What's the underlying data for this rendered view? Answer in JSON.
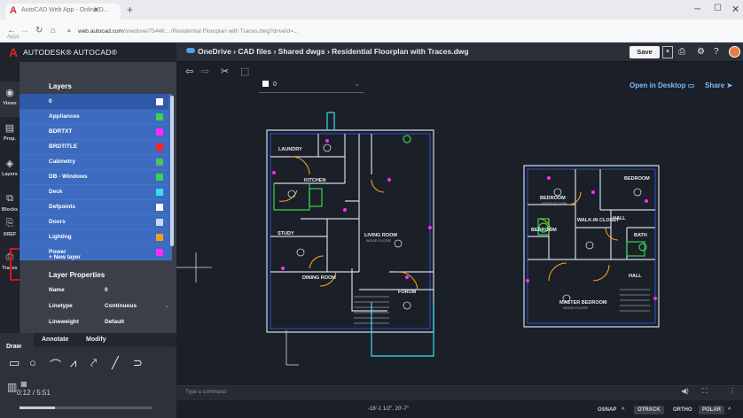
{
  "browser": {
    "tab_title": "AutoCAD Web App - Online D...",
    "url_host": "web.autocad.com",
    "url_rest": "/onedrive/75446... /Residential Floorplan with Traces.dwg?driveId=...",
    "bookmarks_label": "Apps"
  },
  "app": {
    "brand": "AUTODESK® AUTOCAD®",
    "breadcrumb": "OneDrive  ›  CAD files  ›  Shared dwgs  ›  Residential Floorplan with Traces.dwg",
    "save_label": "Save",
    "open_desktop": "Open in Desktop",
    "share_label": "Share"
  },
  "rail": [
    {
      "icon": "views-icon",
      "label": "Views"
    },
    {
      "icon": "properties-icon",
      "label": "Prop."
    },
    {
      "icon": "layers-icon",
      "label": "Layers"
    },
    {
      "icon": "blocks-icon",
      "label": "Blocks"
    },
    {
      "icon": "xref-icon",
      "label": "XREF"
    },
    {
      "icon": "traces-icon",
      "label": "Traces"
    }
  ],
  "layers": {
    "title": "Layers",
    "current": "0",
    "items": [
      {
        "name": "0",
        "color": "#ffffff"
      },
      {
        "name": "Appliances",
        "color": "#39d353"
      },
      {
        "name": "BDRTXT",
        "color": "#ff2bff"
      },
      {
        "name": "BRDTITLE",
        "color": "#ff2020"
      },
      {
        "name": "Cabinetry",
        "color": "#50c060"
      },
      {
        "name": "DB - Windows",
        "color": "#39d353"
      },
      {
        "name": "Deck",
        "color": "#33e0f0"
      },
      {
        "name": "Defpoints",
        "color": "#ffffff"
      },
      {
        "name": "Doors",
        "color": "#cfd8ea"
      },
      {
        "name": "Lighting",
        "color": "#f0a020"
      },
      {
        "name": "Power",
        "color": "#ff2bff"
      }
    ],
    "new_layer": "+ New layer"
  },
  "layer_properties": {
    "title": "Layer Properties",
    "rows": [
      {
        "label": "Name",
        "value": "0"
      },
      {
        "label": "Linetype",
        "value": "Continuous"
      },
      {
        "label": "Lineweight",
        "value": "Default"
      }
    ]
  },
  "tools": {
    "tabs": [
      "Draw",
      "Annotate",
      "Modify"
    ],
    "video_time": "0:12 / 5:51"
  },
  "drawing": {
    "layer_selected": "0",
    "rooms": [
      "LAUNDRY",
      "KITCHEN",
      "STUDY",
      "LIVING ROOM",
      "DINING ROOM",
      "FORUM",
      "BEDROOM",
      "BEDROOM",
      "WALK-IN CLOSET",
      "BEDROOM",
      "HALL",
      "MASTER BEDROOM",
      "BATH",
      "HALL"
    ],
    "floor_note": "WOOD FLOOR"
  },
  "command": {
    "placeholder": "Type a command"
  },
  "status": {
    "coords": "-16'-1 1/2\", 20'-7\"",
    "items": [
      "OSNAP",
      "OTRACK",
      "ORTHO",
      "POLAR"
    ],
    "active": [
      "OTRACK",
      "POLAR"
    ]
  }
}
